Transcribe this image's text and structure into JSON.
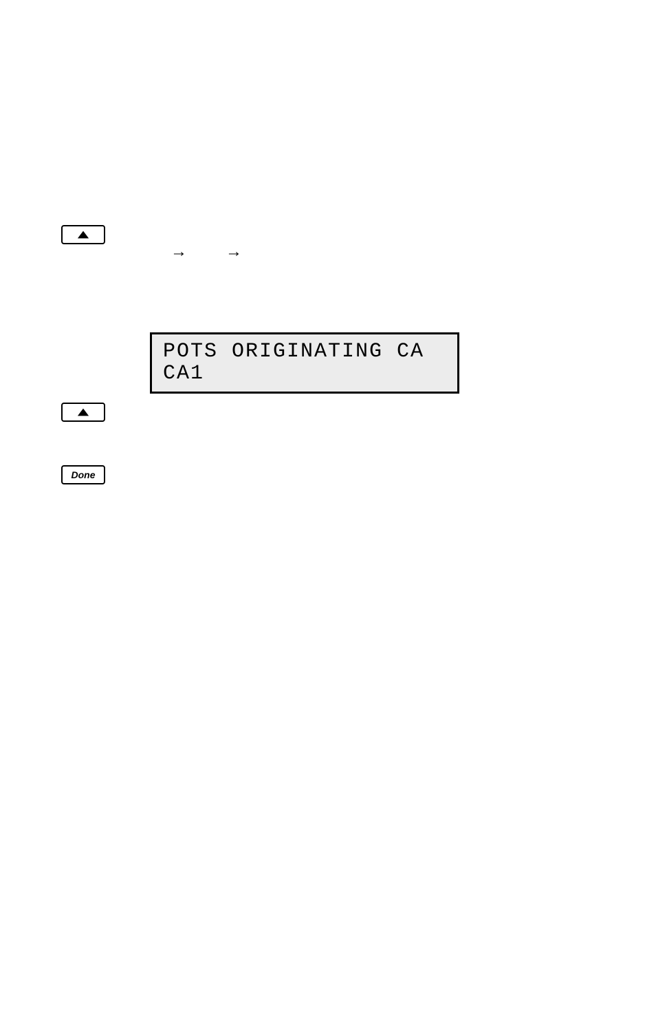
{
  "keys": {
    "done_label": "Done"
  },
  "breadcrumb_arrows": [
    "→",
    "→"
  ],
  "display_line1": "POTS ORIGINATING CA",
  "display_line2": "CA1"
}
